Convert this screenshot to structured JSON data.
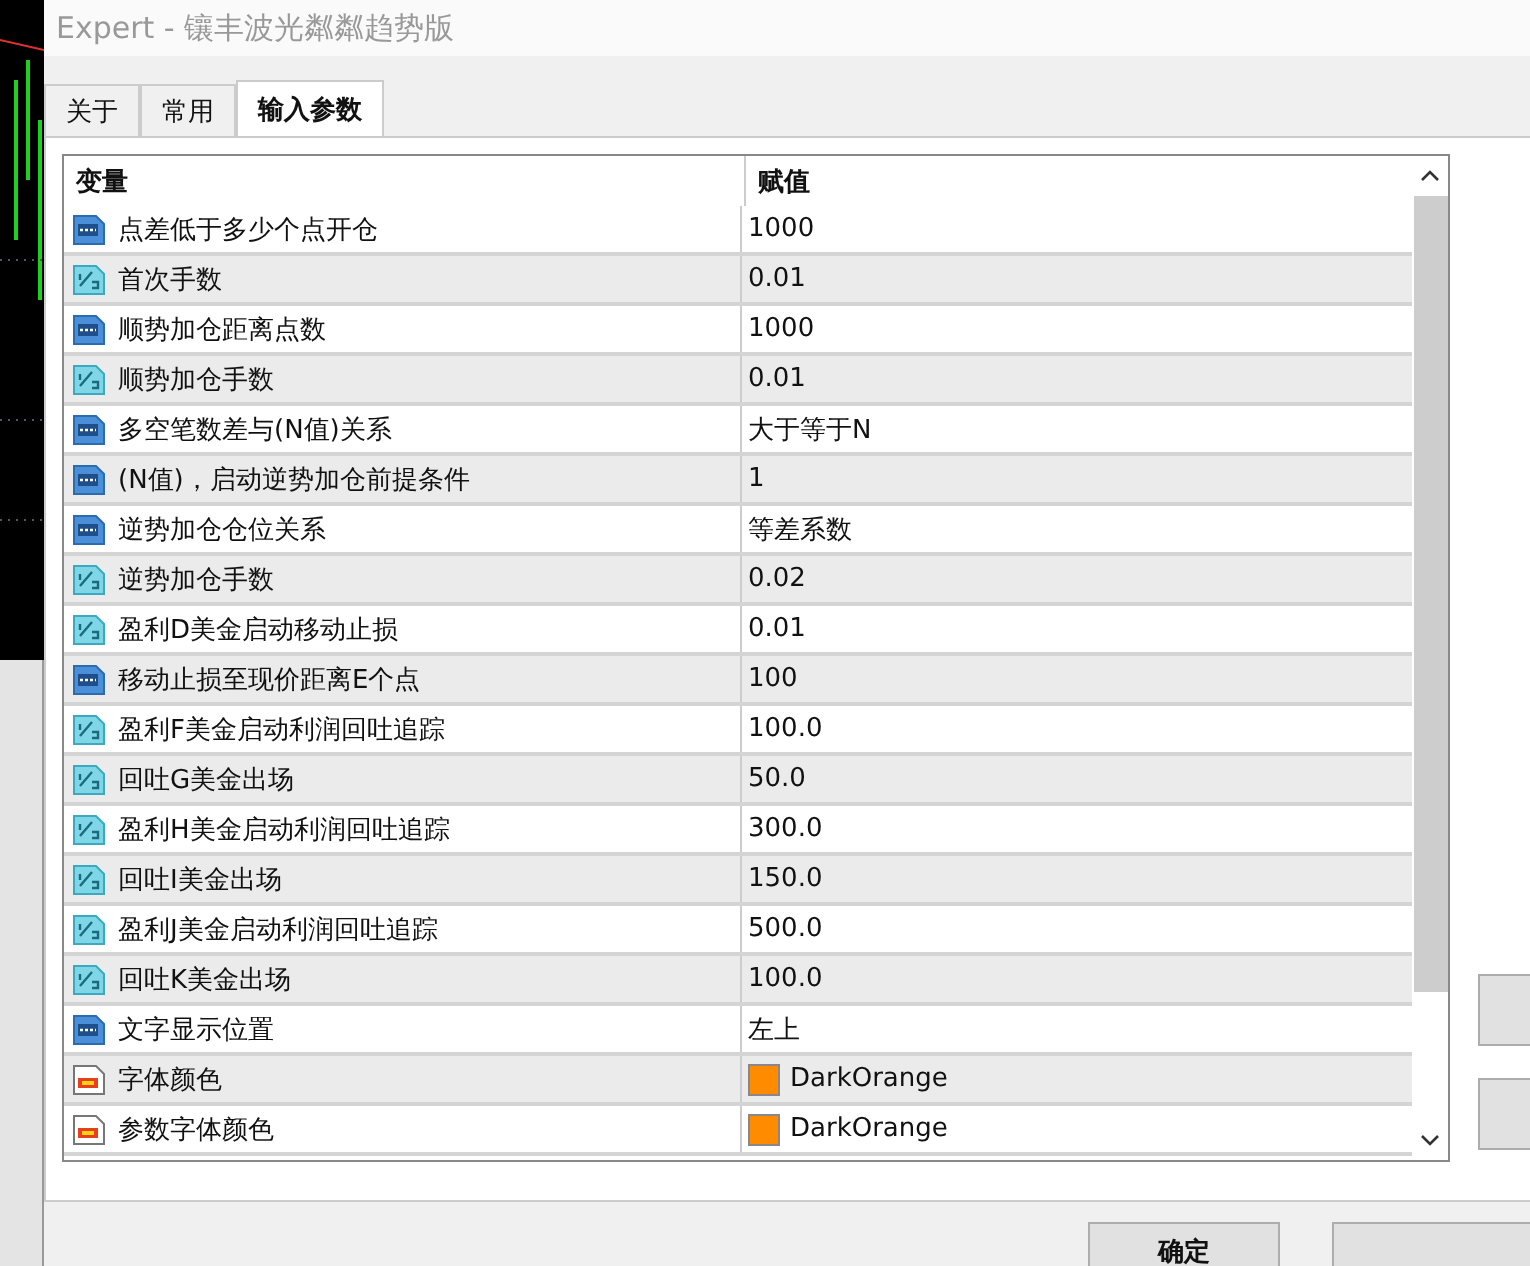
{
  "window": {
    "title": "Expert - 镶丰波光粼粼趋势版"
  },
  "tabs": [
    {
      "label": "关于",
      "selected": false
    },
    {
      "label": "常用",
      "selected": false
    },
    {
      "label": "输入参数",
      "selected": true
    }
  ],
  "table": {
    "columns": [
      "变量",
      "赋值"
    ],
    "rows": [
      {
        "kind": "int",
        "name": "点差低于多少个点开仓",
        "value": "1000"
      },
      {
        "kind": "double",
        "name": "首次手数",
        "value": "0.01"
      },
      {
        "kind": "int",
        "name": "顺势加仓距离点数",
        "value": "1000"
      },
      {
        "kind": "double",
        "name": "顺势加仓手数",
        "value": "0.01"
      },
      {
        "kind": "int",
        "name": "多空笔数差与(N值)关系",
        "value": "大于等于N"
      },
      {
        "kind": "int",
        "name": "(N值)，启动逆势加仓前提条件",
        "value": "1"
      },
      {
        "kind": "int",
        "name": "逆势加仓仓位关系",
        "value": "等差系数"
      },
      {
        "kind": "double",
        "name": "逆势加仓手数",
        "value": "0.02"
      },
      {
        "kind": "double",
        "name": "盈利D美金启动移动止损",
        "value": "0.01"
      },
      {
        "kind": "int",
        "name": "移动止损至现价距离E个点",
        "value": "100"
      },
      {
        "kind": "double",
        "name": "盈利F美金启动利润回吐追踪",
        "value": "100.0"
      },
      {
        "kind": "double",
        "name": "回吐G美金出场",
        "value": "50.0"
      },
      {
        "kind": "double",
        "name": "盈利H美金启动利润回吐追踪",
        "value": "300.0"
      },
      {
        "kind": "double",
        "name": "回吐I美金出场",
        "value": "150.0"
      },
      {
        "kind": "double",
        "name": "盈利J美金启动利润回吐追踪",
        "value": "500.0"
      },
      {
        "kind": "double",
        "name": "回吐K美金出场",
        "value": "100.0"
      },
      {
        "kind": "int",
        "name": "文字显示位置",
        "value": "左上"
      },
      {
        "kind": "color",
        "name": "字体颜色",
        "value": "DarkOrange",
        "color": "#ff8c00"
      },
      {
        "kind": "color",
        "name": "参数字体颜色",
        "value": "DarkOrange",
        "color": "#ff8c00"
      }
    ]
  },
  "buttons": [
    {
      "label": "确定"
    }
  ]
}
